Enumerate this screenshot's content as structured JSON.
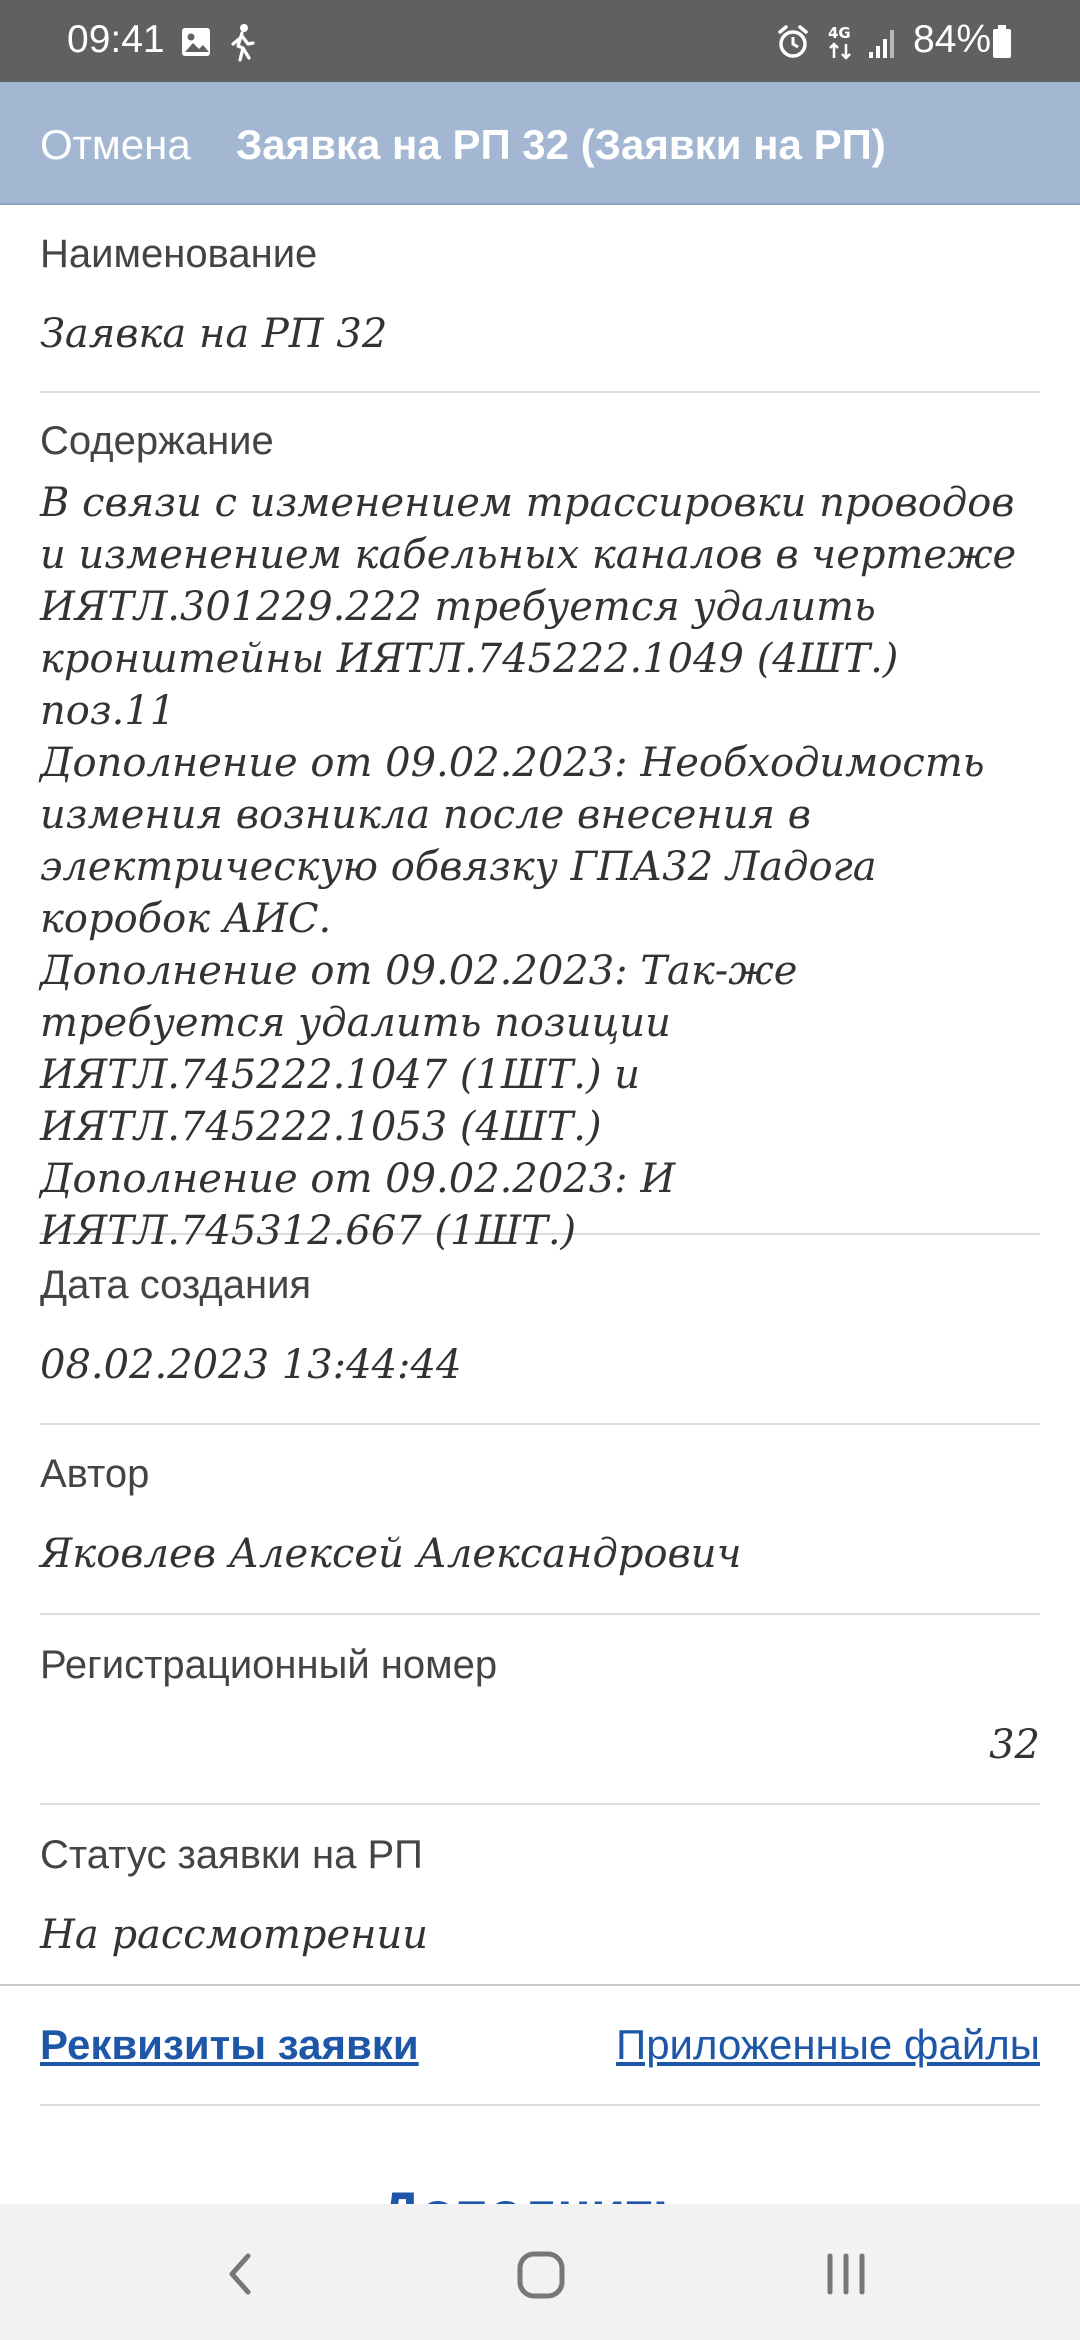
{
  "status_bar": {
    "time": "09:41",
    "left_icons": [
      "image-icon",
      "walk-icon"
    ],
    "right_icons": [
      "alarm-icon",
      "4g-data-icon",
      "signal-icon",
      "battery-icon"
    ],
    "network": "4G",
    "battery": "84%"
  },
  "header": {
    "cancel_label": "Отмена",
    "title": "Заявка на РП 32 (Заявки на РП)",
    "background_color": "#a3b7d3"
  },
  "fields": {
    "name": {
      "label": "Наименование",
      "value": "Заявка на РП 32"
    },
    "content": {
      "label": "Содержание",
      "value": "В связи с изменением трассировки проводов и изменением кабельных каналов в чертеже ИЯТЛ.301229.222 требуется удалить кронштейны ИЯТЛ.745222.1049 (4ШТ.) поз.11\nДополнение от 09.02.2023: Необходимость измения возникла после внесения в электрическую обвязку ГПА32 Ладога коробок АИС.\nДополнение от 09.02.2023: Так-же требуется удалить позиции ИЯТЛ.745222.1047 (1ШТ.) и ИЯТЛ.745222.1053 (4ШТ.)\nДополнение от 09.02.2023: И ИЯТЛ.745312.667 (1ШТ.)"
    },
    "created": {
      "label": "Дата создания",
      "value": "08.02.2023 13:44:44"
    },
    "author": {
      "label": "Автор",
      "value": "Яковлев Алексей Александрович"
    },
    "reg_number": {
      "label": "Регистрационный номер",
      "value": "32"
    },
    "status": {
      "label": "Статус заявки на РП",
      "value": "На рассмотрении"
    }
  },
  "tabs": {
    "requisites": "Реквизиты заявки",
    "attachments": "Приложенные файлы",
    "link_color": "#1f57a8"
  },
  "bottom_action": {
    "label": "Дополнить"
  },
  "nav_bar": {
    "icons": [
      "back-icon",
      "home-icon",
      "recents-icon"
    ]
  }
}
